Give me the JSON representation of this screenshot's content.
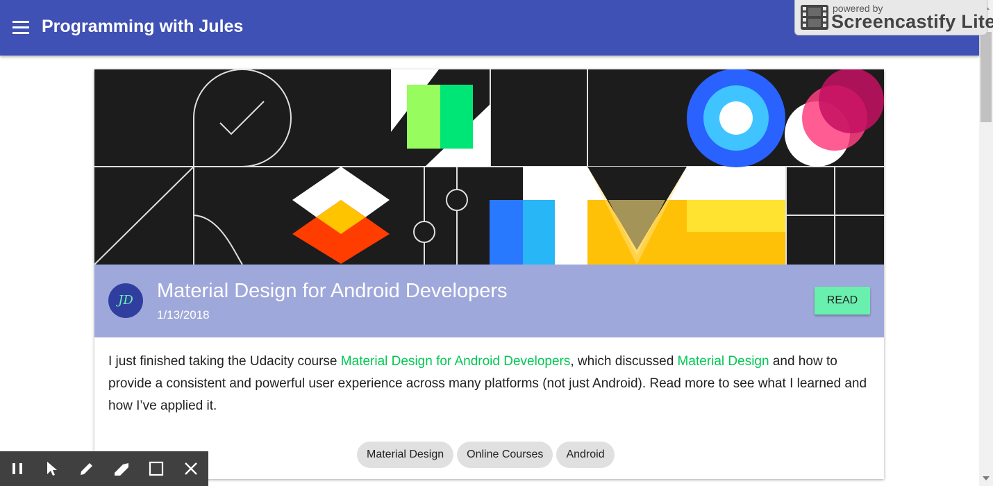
{
  "app": {
    "title": "Programming with Jules"
  },
  "watermark": {
    "line1": "powered by",
    "line2": "Screencastify Lite"
  },
  "post": {
    "author_initials": "JD",
    "title": "Material Design for Android Developers",
    "date": "1/13/2018",
    "read_label": "READ",
    "excerpt": {
      "part1": "I just finished taking the Udacity course ",
      "link1": "Material Design for Android Developers",
      "part2": ", which discussed ",
      "link2": "Material Design",
      "part3": " and how to provide a consistent and powerful user experience across many platforms (not just Android). Read more to see what I learned and how I’ve applied it."
    },
    "tags": [
      "Material Design",
      "Online Courses",
      "Android"
    ]
  },
  "colors": {
    "appbar": "#3f51b5",
    "card_header": "#9fa8da",
    "accent": "#69f0ae",
    "link": "#00c853"
  },
  "recorder_toolbar": {
    "icons": [
      "pause-icon",
      "cursor-icon",
      "pencil-icon",
      "eraser-icon",
      "rectangle-icon",
      "close-icon"
    ]
  }
}
